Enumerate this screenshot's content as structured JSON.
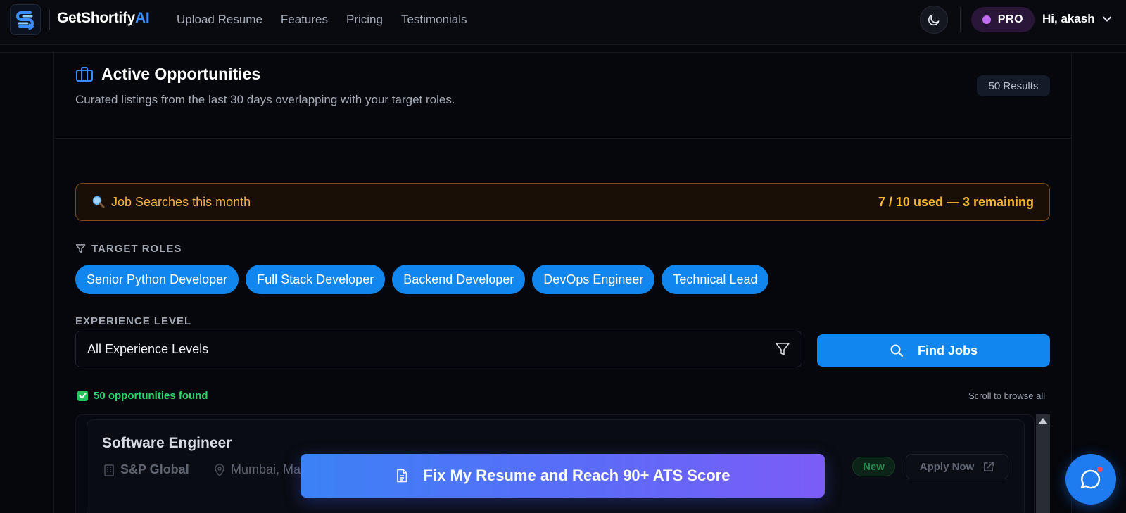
{
  "nav": {
    "brand_main": "GetShortify",
    "brand_ai": "AI",
    "links": [
      "Upload Resume",
      "Features",
      "Pricing",
      "Testimonials"
    ],
    "pro_label": "PRO",
    "user_greeting": "Hi, akash"
  },
  "section": {
    "title": "Active Opportunities",
    "subtitle": "Curated listings from the last 30 days overlapping with your target roles.",
    "results_badge": "50 Results"
  },
  "usage": {
    "label": "Job Searches this month",
    "count": "7 / 10 used — 3 remaining"
  },
  "roles": {
    "label": "TARGET ROLES",
    "items": [
      "Senior Python Developer",
      "Full Stack Developer",
      "Backend Developer",
      "DevOps Engineer",
      "Technical Lead"
    ]
  },
  "experience": {
    "label": "EXPERIENCE LEVEL",
    "selected": "All Experience Levels"
  },
  "find_button": "Find Jobs",
  "results": {
    "found_text": "50 opportunities found",
    "scroll_hint": "Scroll to browse all"
  },
  "job": {
    "title": "Software Engineer",
    "company": "S&P Global",
    "location": "Mumbai, Ma",
    "badge": "New",
    "apply_label": "Apply Now"
  },
  "cta": "Fix My Resume and Reach 90+ ATS Score",
  "colors": {
    "accent": "#1186ef",
    "pro": "#c06cf2",
    "warning": "#f7b731",
    "success": "#22c55e"
  },
  "icons": {
    "theme": "moon-icon",
    "section": "briefcase-icon",
    "usage": "magnifier-emoji-icon",
    "roles": "filter-icon",
    "select": "filter-icon",
    "find": "search-icon",
    "found": "check-square-icon",
    "company": "building-icon",
    "location": "map-pin-icon",
    "apply": "external-link-icon",
    "cta": "document-icon",
    "chat": "chat-bubble-icon"
  }
}
